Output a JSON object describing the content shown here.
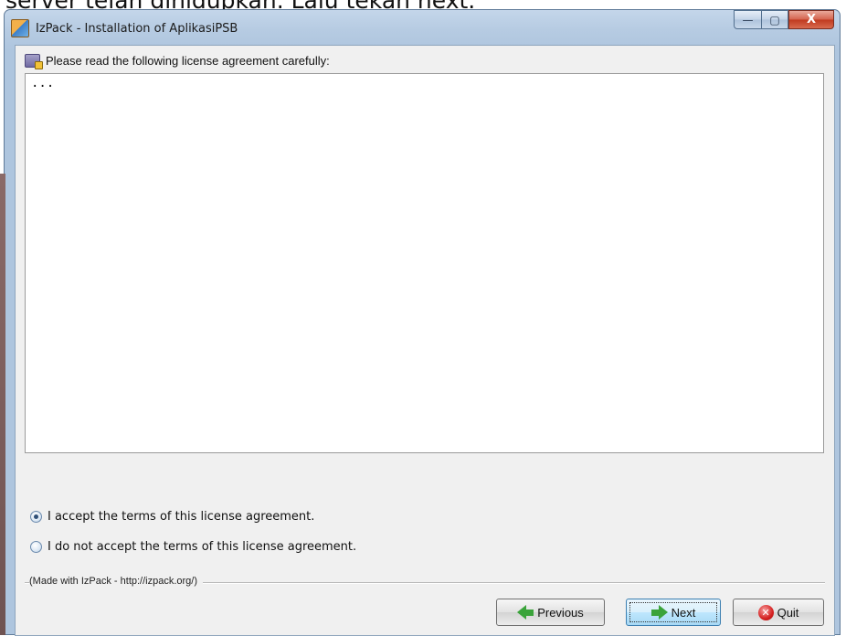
{
  "background_caption": "server telah dihidupkan. Lalu tekan next.",
  "window": {
    "title": "IzPack - Installation of AplikasiPSB",
    "controls": {
      "minimize": "—",
      "maximize": "▢",
      "close": "X"
    }
  },
  "panel": {
    "heading": "Please read the following license agreement carefully:",
    "license_text": "...",
    "options": [
      {
        "label": "I accept the terms of this license agreement.",
        "selected": true
      },
      {
        "label": "I do not accept the terms of this license agreement.",
        "selected": false
      }
    ],
    "made_with": "(Made with IzPack - http://izpack.org/)"
  },
  "buttons": {
    "previous": "Previous",
    "next": "Next",
    "quit": "Quit"
  },
  "icons": {
    "app": "izpack-app-icon",
    "heading": "license-book-icon",
    "previous": "arrow-left-icon",
    "next": "arrow-right-icon",
    "quit": "quit-icon"
  },
  "colors": {
    "titlebar": "#b6cbe2",
    "panel_bg": "#f0f0f0",
    "arrow_green": "#3aa33a",
    "quit_red": "#d52020"
  }
}
